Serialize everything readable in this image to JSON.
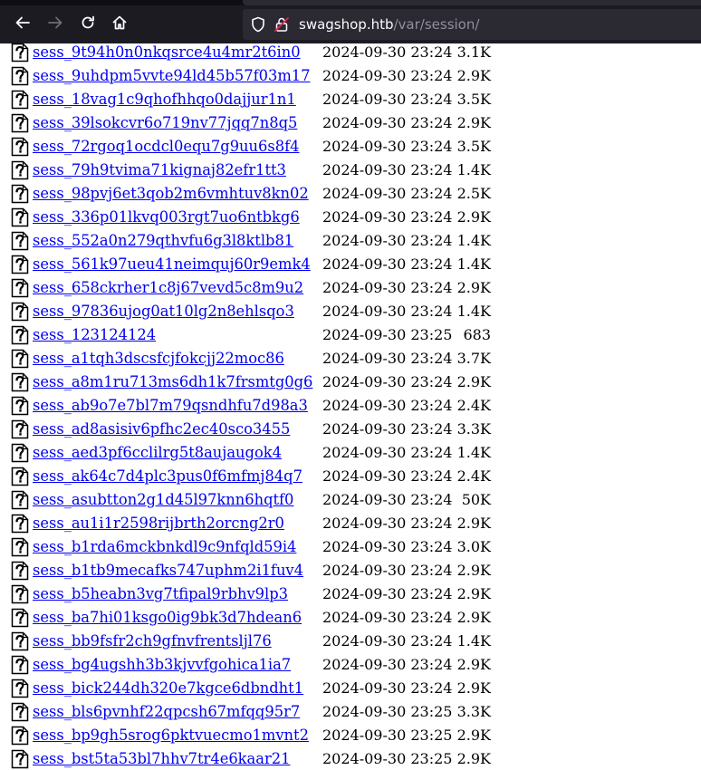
{
  "browser": {
    "url_host": "swagshop.htb",
    "url_path": "/var/session/",
    "icons": [
      "back-arrow-icon",
      "forward-arrow-icon",
      "reload-icon",
      "home-icon",
      "shield-icon",
      "insecure-lock-icon"
    ]
  },
  "colors": {
    "toolbar_bg": "#1c1b22",
    "urlbar_bg": "#2b2a33",
    "link": "#0000ee"
  },
  "files": [
    {
      "name": "sess_9t94h0n0nkqsrce4u4mr2t6in0",
      "date": "2024-09-30 23:24",
      "size": "3.1K"
    },
    {
      "name": "sess_9uhdpm5vvte94ld45b57f03m17",
      "date": "2024-09-30 23:24",
      "size": "2.9K"
    },
    {
      "name": "sess_18vag1c9qhofhhqo0dajjur1n1",
      "date": "2024-09-30 23:24",
      "size": "3.5K"
    },
    {
      "name": "sess_39lsokcvr6o719nv77jqq7n8q5",
      "date": "2024-09-30 23:24",
      "size": "2.9K"
    },
    {
      "name": "sess_72rgoq1ocdcl0equ7g9uu6s8f4",
      "date": "2024-09-30 23:24",
      "size": "3.5K"
    },
    {
      "name": "sess_79h9tvima71kignaj82efr1tt3",
      "date": "2024-09-30 23:24",
      "size": "1.4K"
    },
    {
      "name": "sess_98pvj6et3qob2m6vmhtuv8kn02",
      "date": "2024-09-30 23:24",
      "size": "2.5K"
    },
    {
      "name": "sess_336p01lkvq003rgt7uo6ntbkg6",
      "date": "2024-09-30 23:24",
      "size": "2.9K"
    },
    {
      "name": "sess_552a0n279qthvfu6g3l8ktlb81",
      "date": "2024-09-30 23:24",
      "size": "1.4K"
    },
    {
      "name": "sess_561k97ueu41neimquj60r9emk4",
      "date": "2024-09-30 23:24",
      "size": "1.4K"
    },
    {
      "name": "sess_658ckrher1c8j67vevd5c8m9u2",
      "date": "2024-09-30 23:24",
      "size": "2.9K"
    },
    {
      "name": "sess_97836ujog0at10lg2n8ehlsqo3",
      "date": "2024-09-30 23:24",
      "size": "1.4K"
    },
    {
      "name": "sess_123124124",
      "date": "2024-09-30 23:25",
      "size": "683"
    },
    {
      "name": "sess_a1tqh3dscsfcjfokcjj22moc86",
      "date": "2024-09-30 23:24",
      "size": "3.7K"
    },
    {
      "name": "sess_a8m1ru713ms6dh1k7frsmtg0g6",
      "date": "2024-09-30 23:24",
      "size": "2.9K"
    },
    {
      "name": "sess_ab9o7e7bl7m79qsndhfu7d98a3",
      "date": "2024-09-30 23:24",
      "size": "2.4K"
    },
    {
      "name": "sess_ad8asisiv6pfhc2ec40sco3455",
      "date": "2024-09-30 23:24",
      "size": "3.3K"
    },
    {
      "name": "sess_aed3pf6cclilrg5t8aujaugok4",
      "date": "2024-09-30 23:24",
      "size": "1.4K"
    },
    {
      "name": "sess_ak64c7d4plc3pus0f6mfmj84q7",
      "date": "2024-09-30 23:24",
      "size": "2.4K"
    },
    {
      "name": "sess_asubtton2g1d45l97knn6hqtf0",
      "date": "2024-09-30 23:24",
      "size": "50K"
    },
    {
      "name": "sess_au1i1r2598rijbrth2orcng2r0",
      "date": "2024-09-30 23:24",
      "size": "2.9K"
    },
    {
      "name": "sess_b1rda6mckbnkdl9c9nfqld59i4",
      "date": "2024-09-30 23:24",
      "size": "3.0K"
    },
    {
      "name": "sess_b1tb9mecafks747uphm2i1fuv4",
      "date": "2024-09-30 23:24",
      "size": "2.9K"
    },
    {
      "name": "sess_b5heabn3vg7tfipal9rbhv9lp3",
      "date": "2024-09-30 23:24",
      "size": "2.9K"
    },
    {
      "name": "sess_ba7hi01ksgo0ig9bk3d7hdean6",
      "date": "2024-09-30 23:24",
      "size": "2.9K"
    },
    {
      "name": "sess_bb9fsfr2ch9gfnvfrentsljl76",
      "date": "2024-09-30 23:24",
      "size": "1.4K"
    },
    {
      "name": "sess_bg4ugshh3b3kjvvfgohica1ia7",
      "date": "2024-09-30 23:24",
      "size": "2.9K"
    },
    {
      "name": "sess_bick244dh320e7kgce6dbndht1",
      "date": "2024-09-30 23:24",
      "size": "2.9K"
    },
    {
      "name": "sess_bls6pvnhf22qpcsh67mfqq95r7",
      "date": "2024-09-30 23:25",
      "size": "3.3K"
    },
    {
      "name": "sess_bp9gh5srog6pktvuecmo1mvnt2",
      "date": "2024-09-30 23:25",
      "size": "2.9K"
    },
    {
      "name": "sess_bst5ta53bl7hhv7tr4e6kaar21",
      "date": "2024-09-30 23:25",
      "size": "2.9K"
    }
  ]
}
